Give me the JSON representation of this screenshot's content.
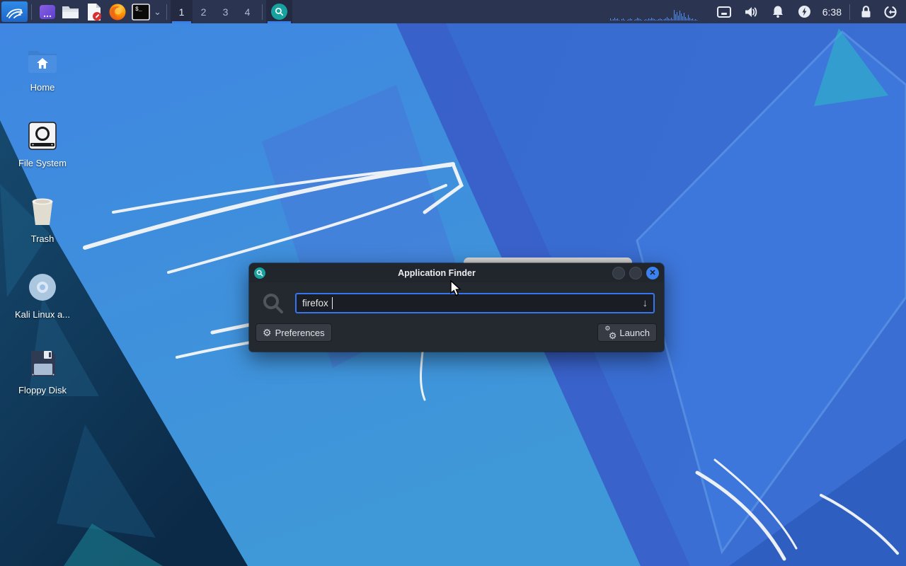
{
  "panel": {
    "launchers": [
      {
        "label": "kali-menu"
      },
      {
        "label": "files-app"
      },
      {
        "label": "file-manager"
      },
      {
        "label": "text-editor"
      },
      {
        "label": "firefox-browser"
      },
      {
        "label": "terminal-emulator"
      }
    ],
    "terminal_label": "$_",
    "workspaces": {
      "items": [
        "1",
        "2",
        "3",
        "4"
      ],
      "active": "1"
    },
    "clock": "6:38",
    "cpu_bars": [
      3,
      1,
      2,
      4,
      2,
      3,
      1,
      0,
      2,
      3,
      1,
      0,
      1,
      2,
      3,
      2,
      0,
      1,
      2,
      4,
      3,
      2,
      1,
      0,
      1,
      2,
      1,
      3,
      2,
      4,
      3,
      2,
      1,
      1,
      2,
      3,
      2,
      1,
      2,
      3,
      5,
      3,
      2,
      4,
      2,
      15,
      9,
      12,
      7,
      14,
      10,
      6,
      11,
      5,
      3,
      8,
      4,
      2,
      3,
      1,
      2,
      1
    ]
  },
  "desktop": {
    "icons": [
      {
        "label": "Home"
      },
      {
        "label": "File System"
      },
      {
        "label": "Trash"
      },
      {
        "label": "Kali Linux a..."
      },
      {
        "label": "Floppy Disk"
      }
    ]
  },
  "finder": {
    "title": "Application Finder",
    "search_value": "firefox",
    "preferences": "Preferences",
    "launch": "Launch"
  },
  "icons": {
    "gear": "⚙",
    "chevron_down": "⌄",
    "arrow_down": "↓",
    "close": "✕"
  },
  "colors": {
    "accent": "#3d7fe8",
    "panel": "#2b3450",
    "close_button": "#3b82f0",
    "appfinder_teal": "#17a2a0",
    "input_border": "#3575f0"
  }
}
